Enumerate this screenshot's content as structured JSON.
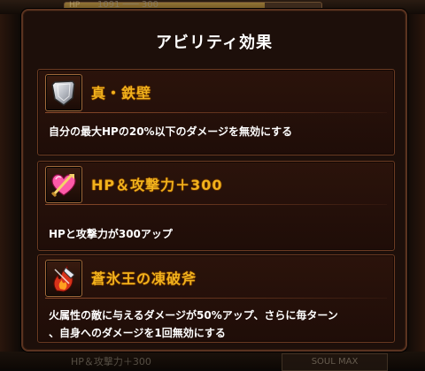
{
  "background": {
    "hp_label": "HP",
    "hp_text": "1091 ─── 300",
    "bottom_text": "HP＆攻撃力＋300",
    "bottom_button": "SOUL MAX"
  },
  "modal": {
    "title": "アビリティ効果"
  },
  "abilities": [
    {
      "icon": "shield-icon",
      "name": "真・鉄壁",
      "description": "自分の最大HPの20%以下のダメージを無効にする"
    },
    {
      "icon": "heart-sword-icon",
      "name": "HP＆攻撃力＋300",
      "description": "HPと攻撃力が300アップ"
    },
    {
      "icon": "flame-axe-icon",
      "name": "蒼氷王の凍破斧",
      "description_lines": [
        "火属性の敵に与えるダメージが50%アップ、さらに毎ターン",
        "、自身へのダメージを1回無効にする"
      ]
    }
  ],
  "colors": {
    "title_gold": "#f2b21c",
    "card_border": "#6b3b22",
    "modal_bg": "#1d0f0a"
  }
}
